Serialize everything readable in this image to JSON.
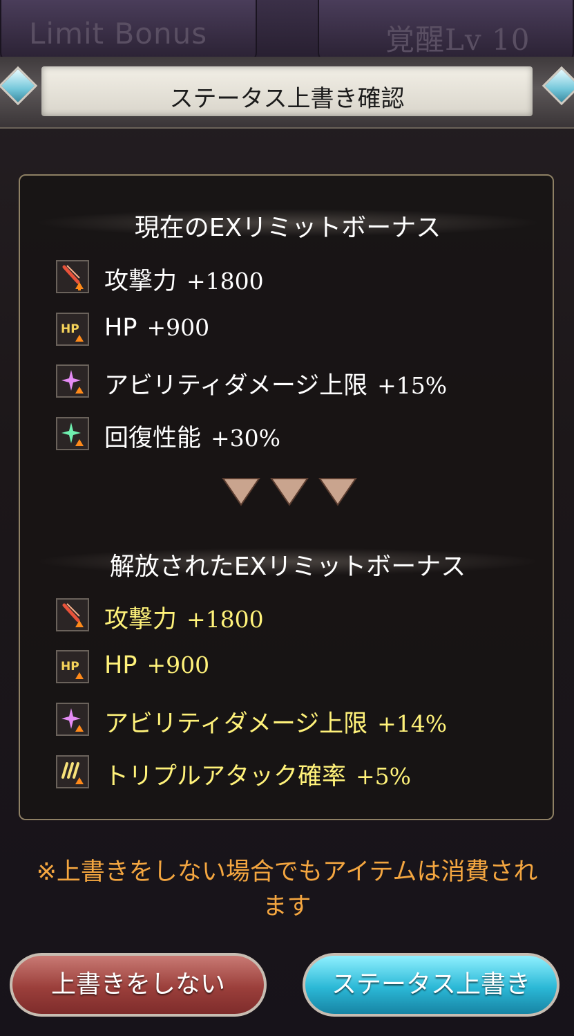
{
  "tabs": {
    "left_label": "Limit Bonus",
    "right_label": "覚醒Lv 10"
  },
  "dialog": {
    "title": "ステータス上書き確認"
  },
  "current": {
    "heading": "現在のEXリミットボーナス",
    "items": [
      {
        "icon": "attack-up-icon",
        "name": "攻撃力",
        "value": "+1800"
      },
      {
        "icon": "hp-up-icon",
        "name": "HP",
        "value": "+900"
      },
      {
        "icon": "ability-damage-cap-up-icon",
        "name": "アビリティダメージ上限",
        "value": "+15%"
      },
      {
        "icon": "healing-up-icon",
        "name": "回復性能",
        "value": "+30%"
      }
    ]
  },
  "released": {
    "heading": "解放されたEXリミットボーナス",
    "items": [
      {
        "icon": "attack-up-icon",
        "name": "攻撃力",
        "value": "+1800"
      },
      {
        "icon": "hp-up-icon",
        "name": "HP",
        "value": "+900"
      },
      {
        "icon": "ability-damage-cap-up-icon",
        "name": "アビリティダメージ上限",
        "value": "+14%"
      },
      {
        "icon": "triple-attack-up-icon",
        "name": "トリプルアタック確率",
        "value": "+5%"
      }
    ]
  },
  "notice": "※上書きをしない場合でもアイテムは消費されます",
  "buttons": {
    "cancel": "上書きをしない",
    "confirm": "ステータス上書き"
  },
  "colors": {
    "new_value": "#fff27a",
    "notice": "#f4a640",
    "confirm_button": "#2bb8d6",
    "cancel_button": "#9b3f3b"
  }
}
